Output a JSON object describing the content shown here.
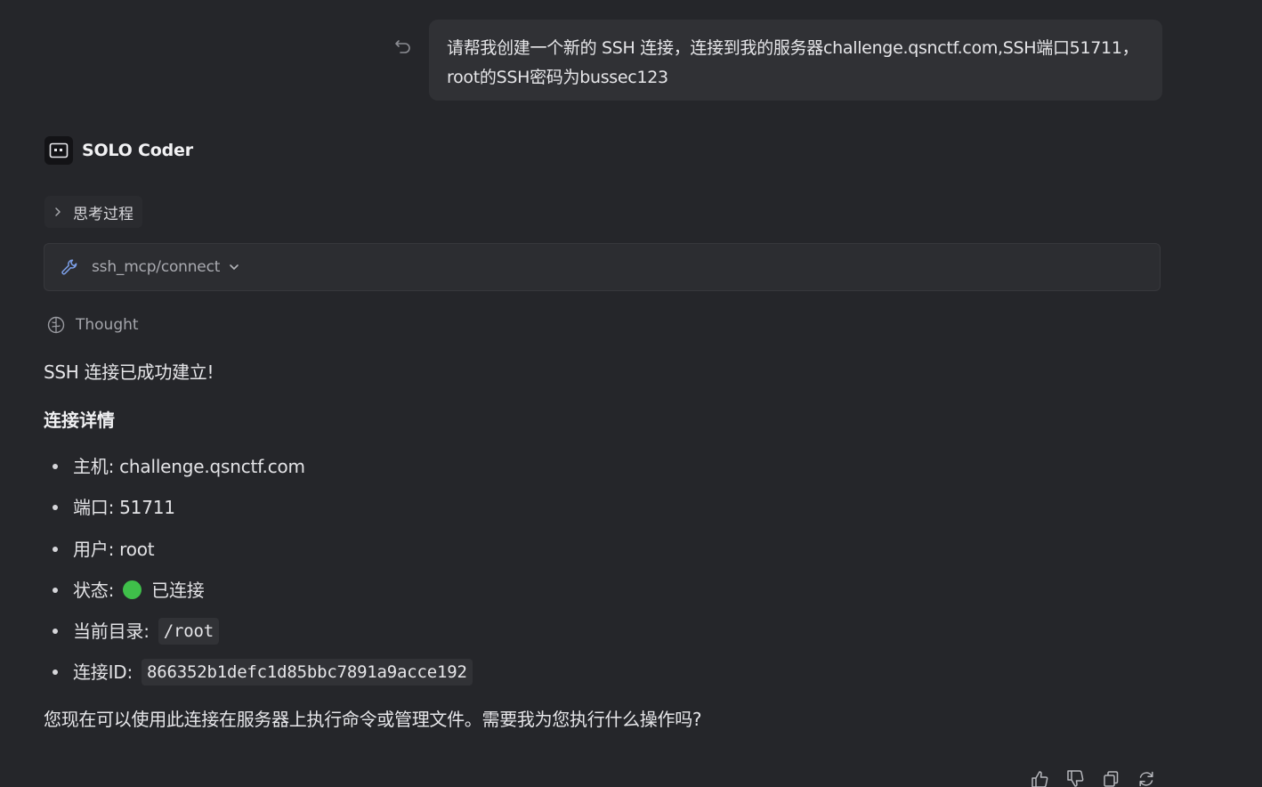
{
  "user_message": {
    "text": "请帮我创建一个新的 SSH 连接，连接到我的服务器challenge.qsnctf.com,SSH端口51711，root的SSH密码为bussec123"
  },
  "agent": {
    "name": "SOLO Coder"
  },
  "thinking": {
    "label": "思考过程"
  },
  "tool_call": {
    "name": "ssh_mcp/connect"
  },
  "thought": {
    "label": "Thought"
  },
  "response": {
    "intro": "SSH 连接已成功建立!",
    "heading": "连接详情",
    "details": {
      "host_label": "主机:",
      "host_value": "challenge.qsnctf.com",
      "port_label": "端口:",
      "port_value": "51711",
      "user_label": "用户:",
      "user_value": "root",
      "status_label": "状态:",
      "status_value": "已连接",
      "status_color": "#3fbf4a",
      "dir_label": "当前目录:",
      "dir_value": "/root",
      "id_label": "连接ID:",
      "id_value": "866352b1defc1d85bbc7891a9acce192"
    },
    "closing": "您现在可以使用此连接在服务器上执行命令或管理文件。需要我为您执行什么操作吗?"
  },
  "icons": {
    "undo": "undo-icon",
    "agent_logo": "terminal-icon",
    "thinking_chevron": "chevron-right-icon",
    "tool": "wrench-icon",
    "tool_chevron": "chevron-down-icon",
    "thought": "brain-icon",
    "like": "thumbs-up-icon",
    "dislike": "thumbs-down-icon",
    "copy": "copy-icon",
    "regenerate": "refresh-icon"
  }
}
